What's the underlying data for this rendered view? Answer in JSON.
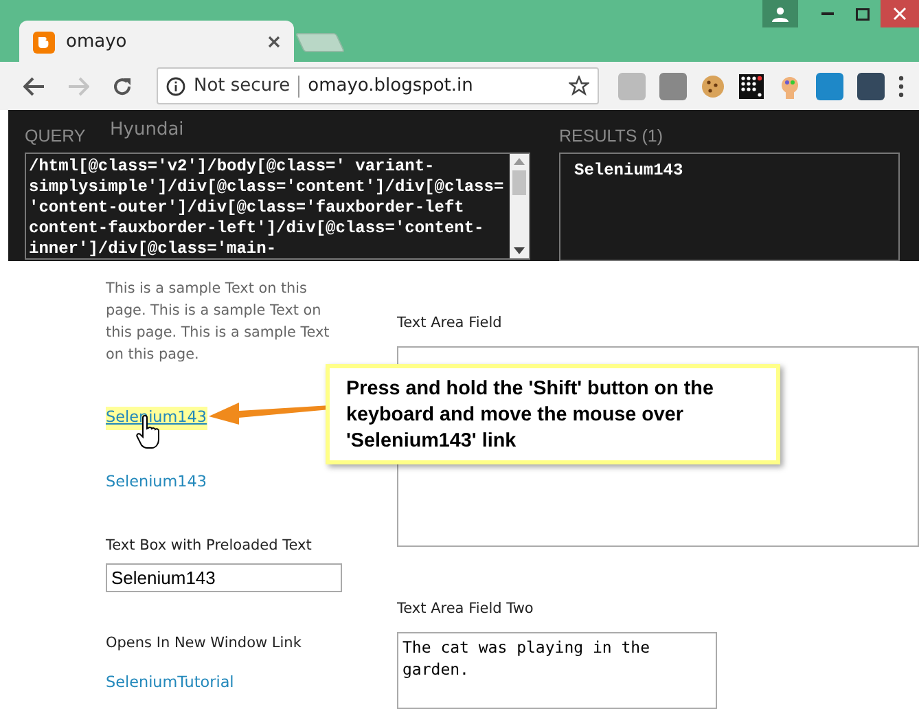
{
  "browser": {
    "tab": {
      "title": "omayo"
    },
    "forward_disabled": true,
    "address": {
      "security": "Not secure",
      "url": "omayo.blogspot.in"
    }
  },
  "xpath_helper": {
    "query_label": "QUERY",
    "query_lines": [
      "/html[@class='v2']/body[@class=' variant-",
      "simplysimple']/div[@class='content']/div[@class=",
      "'content-outer']/div[@class='fauxborder-left",
      "content-fauxborder-left']/div[@class='content-",
      "inner']/div[@class='main-"
    ],
    "results_label": "RESULTS (1)",
    "results": [
      "Selenium143"
    ]
  },
  "page": {
    "listbox_item": "Hyundai",
    "left": [
      {
        "kind": "paragraph",
        "text": "This is a sample Text on this page. This is a sample Text on this page. This is a sample Text on this page."
      },
      {
        "kind": "link",
        "text": "Selenium143",
        "hovered": true
      },
      {
        "kind": "link",
        "text": "Selenium143",
        "hovered": false
      },
      {
        "kind": "label",
        "text": "Text Box with Preloaded Text"
      },
      {
        "kind": "input",
        "value": "Selenium143"
      },
      {
        "kind": "label",
        "text": "Opens In New Window Link"
      },
      {
        "kind": "link",
        "text": "SeleniumTutorial",
        "hovered": false
      }
    ],
    "right": [
      {
        "kind": "label",
        "text": "Text Area Field"
      },
      {
        "kind": "textarea"
      },
      {
        "kind": "label",
        "text": "Text Area Field Two"
      },
      {
        "kind": "textarea",
        "value": "The cat was playing in the garden."
      }
    ]
  },
  "callout": {
    "text": "Press and hold the 'Shift' button on the keyboard and move the mouse over 'Selenium143' link"
  }
}
